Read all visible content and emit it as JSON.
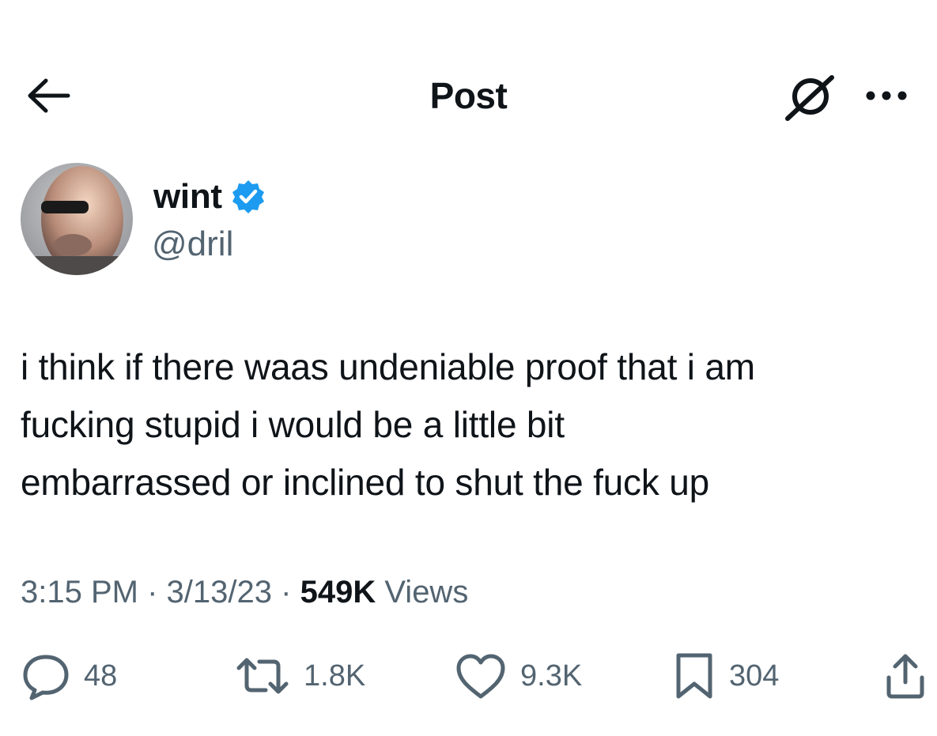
{
  "header": {
    "title": "Post"
  },
  "author": {
    "display_name": "wint",
    "handle": "@dril",
    "verified": true
  },
  "tweet": {
    "lines": [
      "i think if there waas undeniable proof that i am",
      "fucking stupid i would be a little bit",
      "embarrassed or inclined to shut the fuck up"
    ]
  },
  "meta": {
    "time": "3:15 PM",
    "sep1": "·",
    "date": "3/13/23",
    "sep2": "·",
    "views_count": "549K",
    "views_label": "Views"
  },
  "actions": {
    "replies": "48",
    "reposts": "1.8K",
    "likes": "9.3K",
    "bookmarks": "304"
  },
  "colors": {
    "text": "#0f1419",
    "secondary": "#536471",
    "verified": "#1d9bf0"
  }
}
